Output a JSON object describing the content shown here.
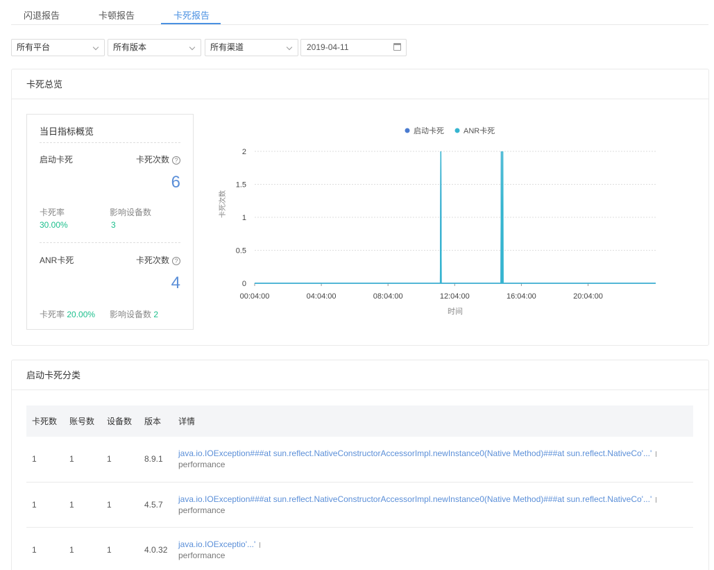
{
  "tabs": [
    {
      "label": "闪退报告",
      "active": false
    },
    {
      "label": "卡顿报告",
      "active": false
    },
    {
      "label": "卡死报告",
      "active": true
    }
  ],
  "filters": {
    "platform": "所有平台",
    "version": "所有版本",
    "channel": "所有渠道",
    "date": "2019-04-11"
  },
  "overview": {
    "title": "卡死总览",
    "summary": {
      "title": "当日指标概览",
      "startup": {
        "label": "启动卡死",
        "count_label": "卡死次数",
        "count": "6",
        "rate_label": "卡死率",
        "rate": "30.00%",
        "devices_label": "影响设备数",
        "devices": "3"
      },
      "anr": {
        "label": "ANR卡死",
        "count_label": "卡死次数",
        "count": "4",
        "rate_label": "卡死率",
        "rate": "20.00%",
        "devices_label": "影响设备数",
        "devices": "2"
      }
    }
  },
  "chart_data": {
    "type": "line",
    "xlabel": "时间",
    "ylabel": "卡死次数",
    "ylim": [
      0,
      2
    ],
    "yticks": [
      "2",
      "1.5",
      "1",
      "0.5",
      "0"
    ],
    "xticks": [
      "00:04:00",
      "04:04:00",
      "08:04:00",
      "12:04:00",
      "16:04:00",
      "20:04:00"
    ],
    "legend_position": "top-center",
    "grid": true,
    "series": [
      {
        "name": "启动卡死",
        "color": "#4a7bd0",
        "spikes": [
          {
            "time": "11:14:00",
            "value": 2
          },
          {
            "time": "14:52:00",
            "value": 2
          }
        ]
      },
      {
        "name": "ANR卡死",
        "color": "#36b5d0",
        "spikes": [
          {
            "time": "11:14:00",
            "value": 2
          },
          {
            "time": "14:52:00",
            "value": 2
          },
          {
            "time": "14:57:00",
            "value": 2
          }
        ]
      }
    ]
  },
  "classification": {
    "title": "启动卡死分类",
    "columns": [
      "卡死数",
      "账号数",
      "设备数",
      "版本",
      "详情"
    ],
    "rows": [
      {
        "crashes": "1",
        "accounts": "1",
        "devices": "1",
        "version": "8.9.1",
        "detail": "java.io.IOException###at sun.reflect.NativeConstructorAccessorImpl.newInstance0(Native Method)###at sun.reflect.NativeCo'...'",
        "sub": "performance"
      },
      {
        "crashes": "1",
        "accounts": "1",
        "devices": "1",
        "version": "4.5.7",
        "detail": "java.io.IOException###at sun.reflect.NativeConstructorAccessorImpl.newInstance0(Native Method)###at sun.reflect.NativeCo'...'",
        "sub": "performance"
      },
      {
        "crashes": "1",
        "accounts": "1",
        "devices": "1",
        "version": "4.0.32",
        "detail": "java.io.IOExceptio'...'",
        "sub": "performance"
      }
    ]
  }
}
